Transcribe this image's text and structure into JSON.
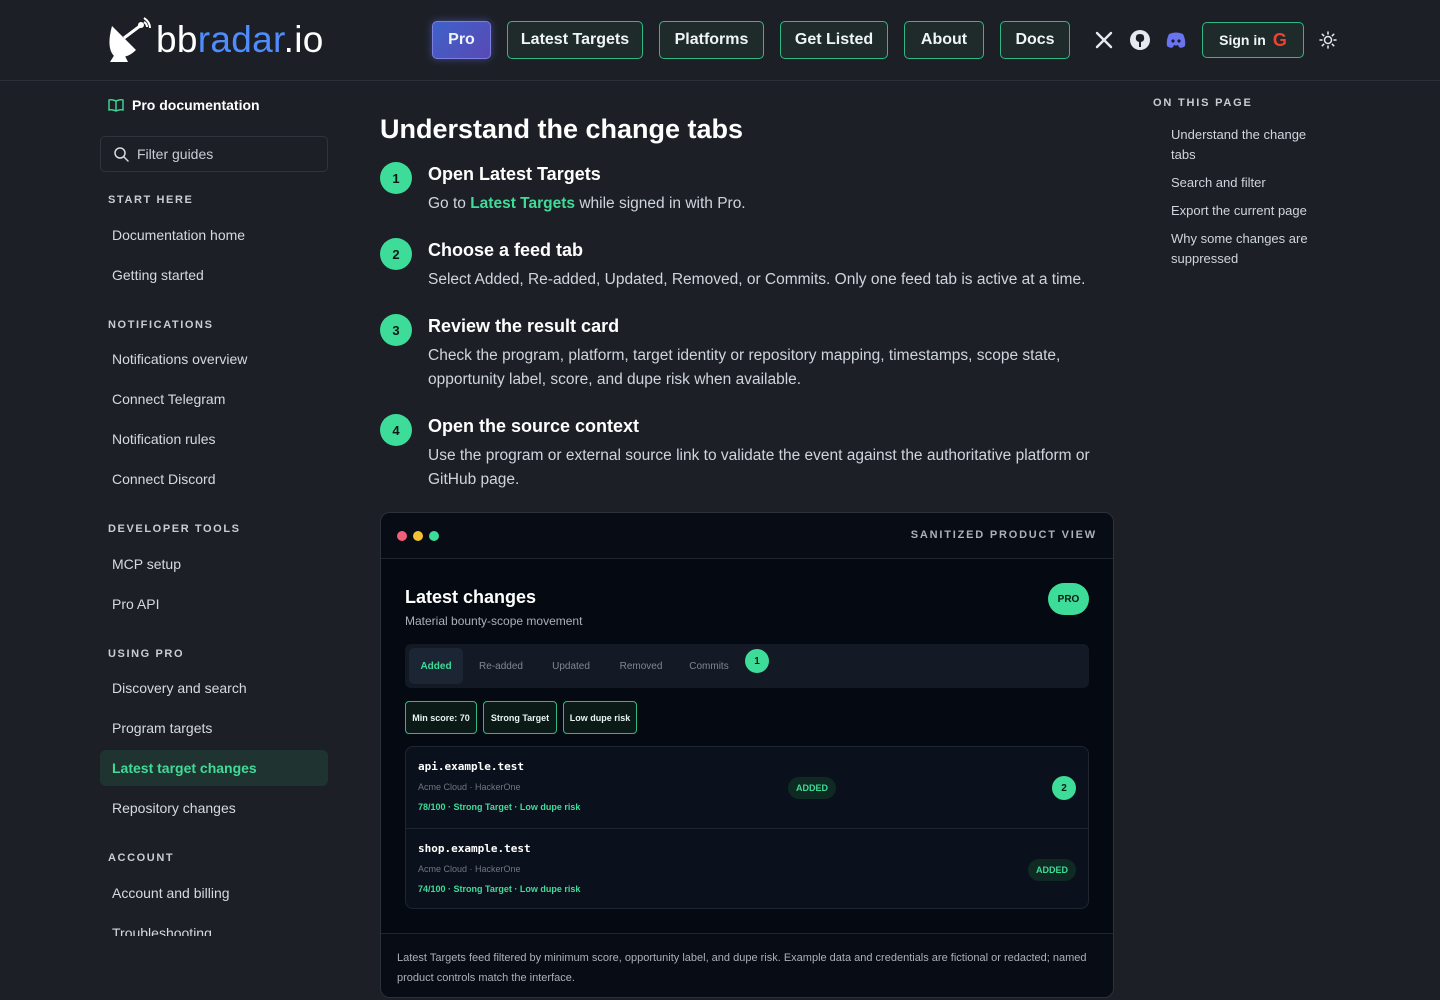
{
  "header": {
    "logo_text_a": "bb",
    "logo_text_b": "radar",
    "logo_text_c": ".io",
    "nav": [
      "Pro",
      "Latest Targets",
      "Platforms",
      "Get Listed",
      "About",
      "Docs"
    ],
    "signin_label": "Sign in",
    "icons": [
      "x-icon",
      "github-icon",
      "discord-icon",
      "google-icon",
      "theme-toggle-icon"
    ]
  },
  "sidebar": {
    "title": "Pro documentation",
    "filter_placeholder": "Filter guides",
    "sections": [
      {
        "label": "START HERE",
        "items": [
          "Documentation home",
          "Getting started"
        ]
      },
      {
        "label": "NOTIFICATIONS",
        "items": [
          "Notifications overview",
          "Connect Telegram",
          "Notification rules",
          "Connect Discord"
        ]
      },
      {
        "label": "DEVELOPER TOOLS",
        "items": [
          "MCP setup",
          "Pro API"
        ]
      },
      {
        "label": "USING PRO",
        "items": [
          "Discovery and search",
          "Program targets",
          "Latest target changes",
          "Repository changes"
        ]
      },
      {
        "label": "ACCOUNT",
        "items": [
          "Account and billing",
          "Troubleshooting"
        ]
      }
    ],
    "active_item": "Latest target changes"
  },
  "main": {
    "title": "Understand the change tabs",
    "steps": [
      {
        "num": "1",
        "title": "Open Latest Targets",
        "body_pre": "Go to ",
        "body_link": "Latest Targets",
        "body_post": " while signed in with Pro."
      },
      {
        "num": "2",
        "title": "Choose a feed tab",
        "body": "Select Added, Re-added, Updated, Removed, or Commits. Only one feed tab is active at a time."
      },
      {
        "num": "3",
        "title": "Review the result card",
        "body": "Check the program, platform, target identity or repository mapping, timestamps, scope state, opportunity label, score, and dupe risk when available."
      },
      {
        "num": "4",
        "title": "Open the source context",
        "body": "Use the program or external source link to validate the event against the authoritative platform or GitHub page."
      }
    ]
  },
  "product_view": {
    "label": "SANITIZED PRODUCT VIEW",
    "title": "Latest changes",
    "subtitle": "Material bounty-scope movement",
    "badge": "PRO",
    "tabs": [
      "Added",
      "Re-added",
      "Updated",
      "Removed",
      "Commits"
    ],
    "active_tab": "Added",
    "tab_marker": "1",
    "chips": [
      "Min score: 70",
      "Strong Target",
      "Low dupe risk"
    ],
    "rows": [
      {
        "host": "api.example.test",
        "program": "Acme Cloud · HackerOne",
        "score": "78/100 · Strong Target · Low dupe risk",
        "status": "ADDED",
        "marker": "2"
      },
      {
        "host": "shop.example.test",
        "program": "Acme Cloud · HackerOne",
        "score": "74/100 · Strong Target · Low dupe risk",
        "status": "ADDED"
      }
    ],
    "footer": "Latest Targets feed filtered by minimum score, opportunity label, and dupe risk. Example data and credentials are fictional or redacted; named product controls match the interface."
  },
  "toc": {
    "heading": "ON THIS PAGE",
    "items": [
      "Understand the change tabs",
      "Search and filter",
      "Export the current page",
      "Why some changes are suppressed"
    ]
  },
  "colors": {
    "accent": "#3ddc98",
    "brand_blue": "#4f8dff",
    "background": "#1c2026",
    "panel": "#050912"
  }
}
